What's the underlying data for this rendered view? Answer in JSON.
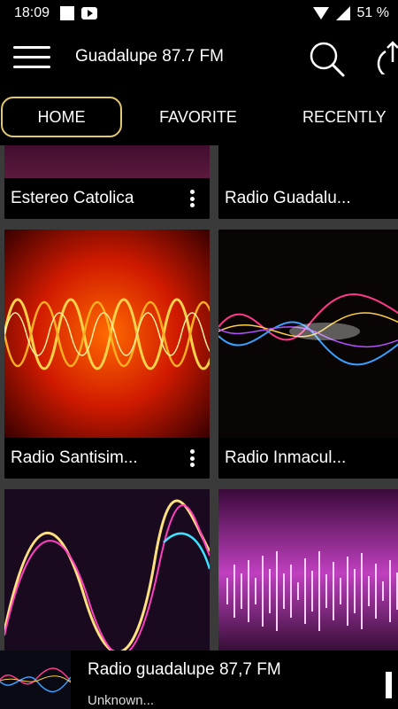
{
  "status": {
    "time": "18:09",
    "battery": "51 %"
  },
  "appbar": {
    "title": "Guadalupe 87.7 FM",
    "icons": [
      "menu-icon",
      "search-icon",
      "share-icon"
    ]
  },
  "tabs": [
    {
      "label": "HOME",
      "active": true
    },
    {
      "label": "FAVORITE",
      "active": false
    },
    {
      "label": "RECENTLY",
      "active": false
    }
  ],
  "stations": [
    {
      "name": "Estereo Catolica"
    },
    {
      "name": "Radio Guadalu..."
    },
    {
      "name": "Radio Santisim..."
    },
    {
      "name": "Radio Inmacul..."
    }
  ],
  "player": {
    "title": "Radio guadalupe 87,7 FM",
    "subtitle": "Unknown..."
  },
  "colors": {
    "accent_border": "#e2c971",
    "background": "#000000",
    "grid_gap": "#3a3a3a"
  }
}
